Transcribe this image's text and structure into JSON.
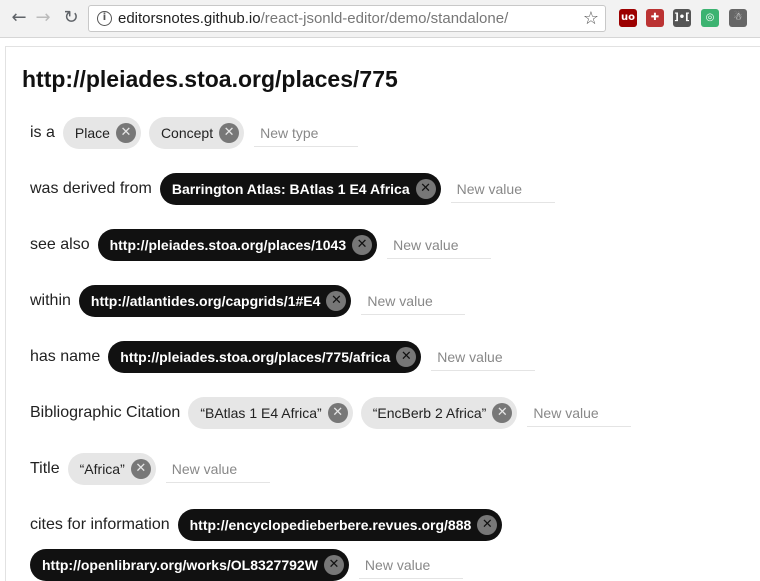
{
  "browser": {
    "url_host": "editorsnotes.github.io",
    "url_path": "/react-jsonld-editor/demo/standalone/",
    "extensions": [
      {
        "name": "ublock-icon",
        "text": "uo",
        "color": "#9c0000"
      },
      {
        "name": "ext2-icon",
        "text": "✚",
        "color": "#b33"
      },
      {
        "name": "ext3-icon",
        "text": "]•[",
        "color": "#555"
      },
      {
        "name": "ext4-icon",
        "text": "◎",
        "color": "#3cb371"
      },
      {
        "name": "ext5-icon",
        "text": "☃",
        "color": "#666"
      }
    ]
  },
  "page": {
    "title": "http://pleiades.stoa.org/places/775",
    "rows": [
      {
        "label": "is a",
        "values": [
          {
            "text": "Place",
            "style": "light"
          },
          {
            "text": "Concept",
            "style": "light"
          }
        ],
        "placeholder": "New type"
      },
      {
        "label": "was derived from",
        "values": [
          {
            "text": "Barrington Atlas: BAtlas 1 E4 Africa",
            "style": "dark"
          }
        ],
        "placeholder": "New value"
      },
      {
        "label": "see also",
        "values": [
          {
            "text": "http://pleiades.stoa.org/places/1043",
            "style": "dark"
          }
        ],
        "placeholder": "New value"
      },
      {
        "label": "within",
        "values": [
          {
            "text": "http://atlantides.org/capgrids/1#E4",
            "style": "dark"
          }
        ],
        "placeholder": "New value"
      },
      {
        "label": "has name",
        "values": [
          {
            "text": "http://pleiades.stoa.org/places/775/africa",
            "style": "dark"
          }
        ],
        "placeholder": "New value"
      },
      {
        "label": "Bibliographic Citation",
        "values": [
          {
            "text": "“BAtlas 1 E4 Africa”",
            "style": "light"
          },
          {
            "text": "“EncBerb 2 Africa”",
            "style": "light"
          }
        ],
        "placeholder": "New value"
      },
      {
        "label": "Title",
        "values": [
          {
            "text": "“Africa”",
            "style": "light"
          }
        ],
        "placeholder": "New value"
      },
      {
        "label": "cites for information",
        "values": [
          {
            "text": "http://encyclopedieberbere.revues.org/888",
            "style": "dark"
          }
        ],
        "placeholder": null
      },
      {
        "label": "",
        "values": [
          {
            "text": "http://openlibrary.org/works/OL8327792W",
            "style": "dark"
          }
        ],
        "placeholder": "New value"
      }
    ]
  }
}
